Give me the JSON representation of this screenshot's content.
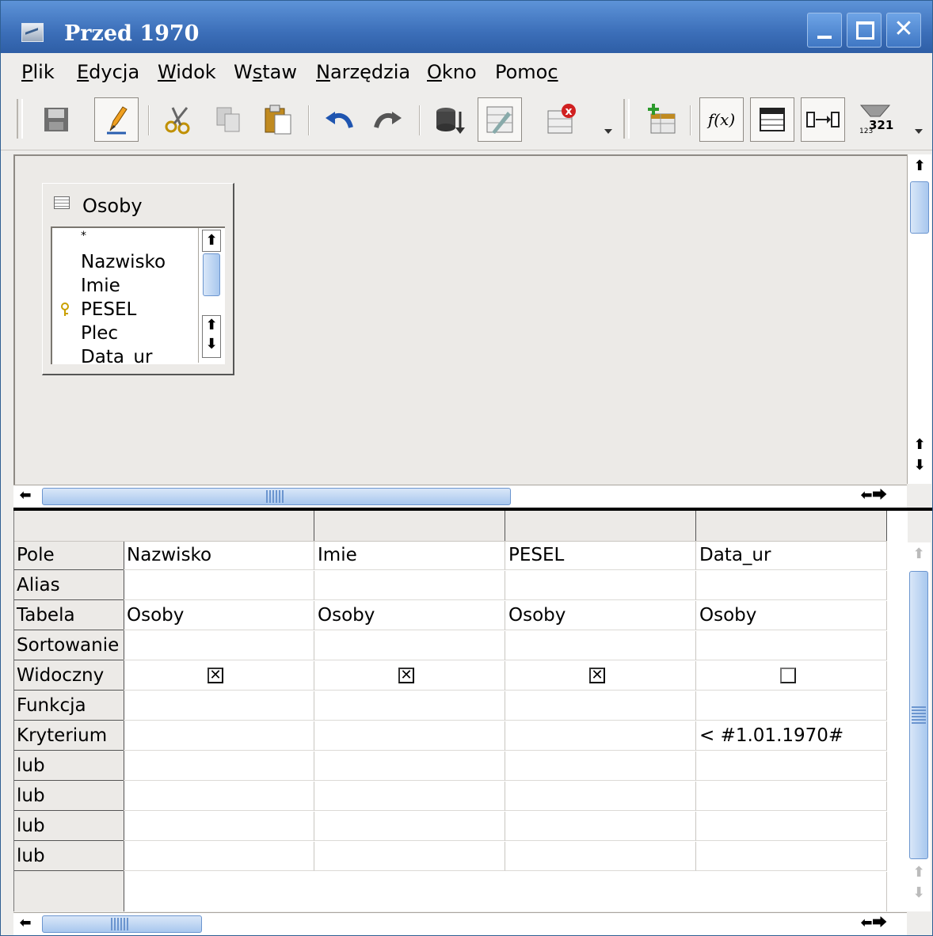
{
  "window": {
    "title": "Przed 1970"
  },
  "menu": [
    {
      "pre": "",
      "u": "P",
      "post": "lik"
    },
    {
      "pre": "",
      "u": "E",
      "post": "dycja"
    },
    {
      "pre": "",
      "u": "W",
      "post": "idok"
    },
    {
      "pre": "W",
      "u": "s",
      "post": "taw"
    },
    {
      "pre": "",
      "u": "N",
      "post": "arzędzia"
    },
    {
      "pre": "",
      "u": "O",
      "post": "kno"
    },
    {
      "pre": "Pomo",
      "u": "c",
      "post": ""
    }
  ],
  "table_window": {
    "title": "Osoby",
    "fields": [
      "*",
      "Nazwisko",
      "Imie",
      "PESEL",
      "Plec",
      "Data_ur"
    ]
  },
  "toolbar": {
    "function_label": "f(x)",
    "sort_label": "321",
    "sort_sub": "123"
  },
  "grid": {
    "row_labels": [
      "Pole",
      "Alias",
      "Tabela",
      "Sortowanie",
      "Widoczny",
      "Funkcja",
      "Kryterium",
      "lub",
      "lub",
      "lub",
      "lub"
    ],
    "columns": [
      {
        "field": "Nazwisko",
        "alias": "",
        "table": "Osoby",
        "sort": "",
        "visible": true,
        "function": "",
        "criterion": ""
      },
      {
        "field": "Imie",
        "alias": "",
        "table": "Osoby",
        "sort": "",
        "visible": true,
        "function": "",
        "criterion": ""
      },
      {
        "field": "PESEL",
        "alias": "",
        "table": "Osoby",
        "sort": "",
        "visible": true,
        "function": "",
        "criterion": ""
      },
      {
        "field": "Data_ur",
        "alias": "",
        "table": "Osoby",
        "sort": "",
        "visible": false,
        "function": "",
        "criterion": "< #1.01.1970#"
      }
    ]
  },
  "colors": {
    "titlebar": "#3c6fb9",
    "accent": "#a8c7ee"
  }
}
